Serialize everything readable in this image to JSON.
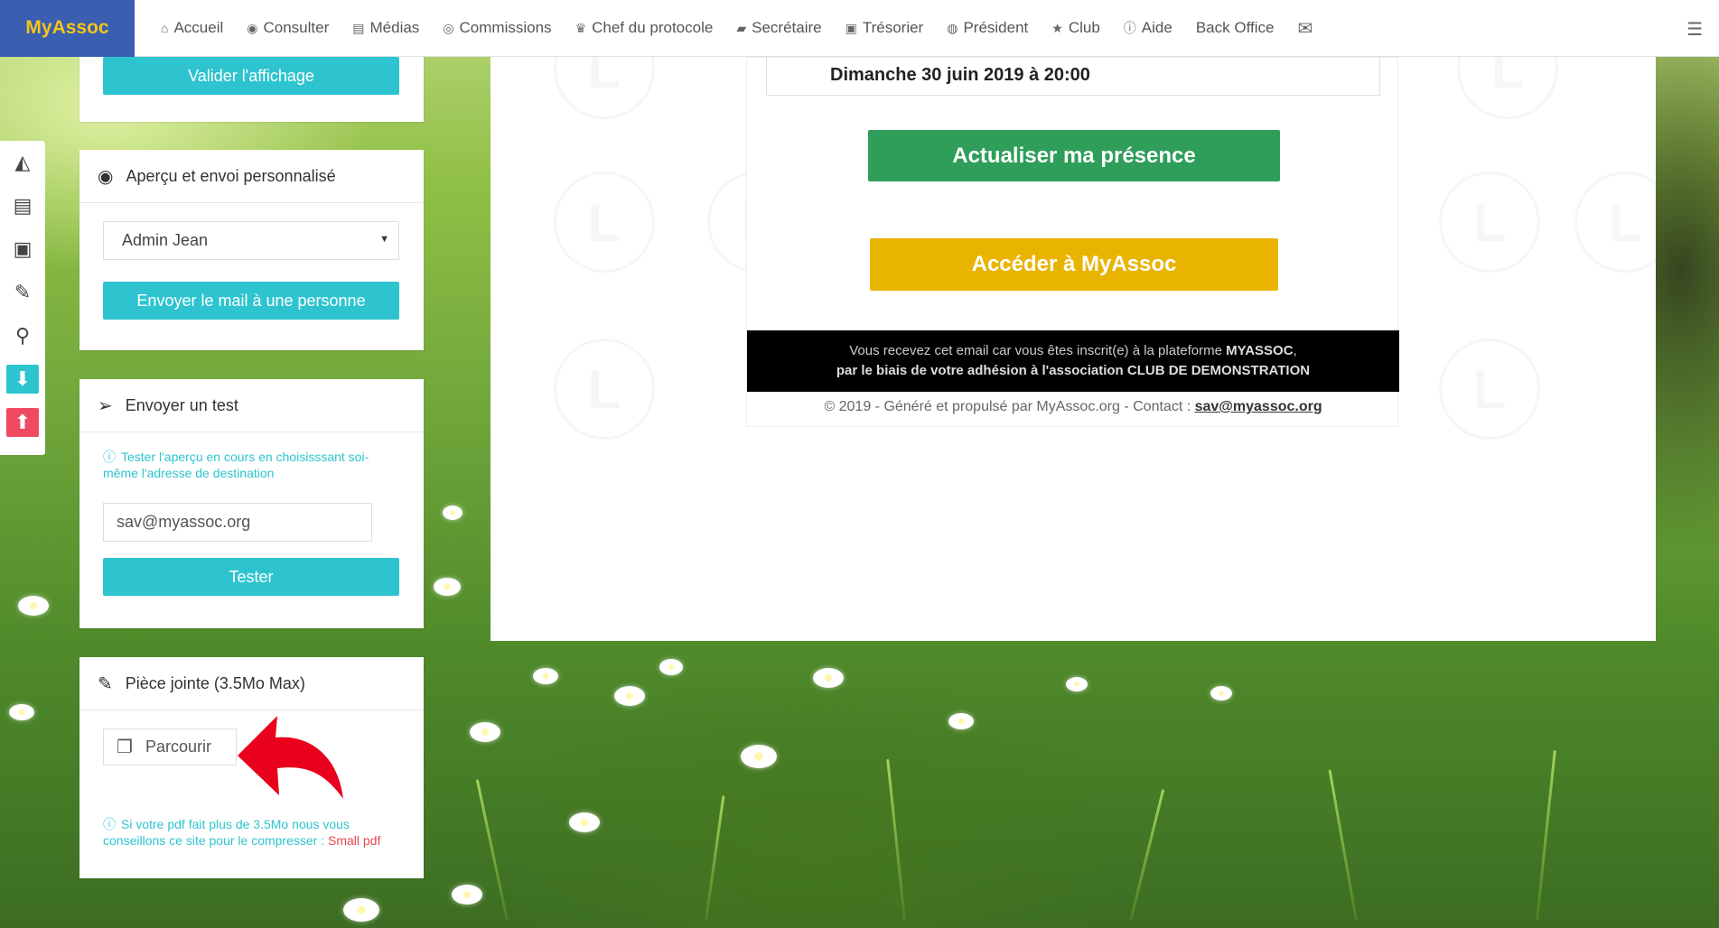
{
  "brand": "MyAssoc",
  "nav": [
    {
      "icon": "home-icon",
      "glyph": "⌂",
      "label": "Accueil"
    },
    {
      "icon": "eye-icon",
      "glyph": "◉",
      "label": "Consulter"
    },
    {
      "icon": "file-icon",
      "glyph": "▤",
      "label": "Médias"
    },
    {
      "icon": "users-icon",
      "glyph": "◎",
      "label": "Commissions"
    },
    {
      "icon": "trophy-icon",
      "glyph": "♛",
      "label": "Chef du protocole"
    },
    {
      "icon": "book-icon",
      "glyph": "▰",
      "label": "Secrétaire"
    },
    {
      "icon": "money-icon",
      "glyph": "▣",
      "label": "Trésorier"
    },
    {
      "icon": "globe-icon",
      "glyph": "◍",
      "label": "Président"
    },
    {
      "icon": "star-icon",
      "glyph": "★",
      "label": "Club"
    },
    {
      "icon": "info-icon",
      "glyph": "ⓘ",
      "label": "Aide"
    },
    {
      "icon": "",
      "glyph": "",
      "label": "Back Office"
    },
    {
      "icon": "envelope-icon",
      "glyph": "✉",
      "label": ""
    }
  ],
  "panels": {
    "display": {
      "button": "Valider l'affichage"
    },
    "preview": {
      "title": "Aperçu et envoi personnalisé",
      "selected_person": "Admin Jean",
      "button": "Envoyer le mail à une personne"
    },
    "test": {
      "title": "Envoyer un test",
      "hint": "Tester l'aperçu en cours en choisisssant soi-même l'adresse de destination",
      "email_value": "sav@myassoc.org",
      "button": "Tester"
    },
    "attachment": {
      "title": "Pièce jointe (3.5Mo Max)",
      "browse": "Parcourir",
      "hint": "Si votre pdf fait plus de 3.5Mo nous vous conseillons ce site pour le compresser :",
      "hint_link": "Small pdf"
    }
  },
  "email": {
    "date": "Dimanche 30 juin 2019 à 20:00",
    "btn_presence": "Actualiser ma présence",
    "btn_access": "Accéder à MyAssoc",
    "footer_line1_prefix": "Vous recevez cet email car vous êtes inscrit(e) à la plateforme ",
    "footer_line1_brand": "MYASSOC",
    "footer_line1_suffix": ",",
    "footer_line2": "par le biais de votre adhésion à l'association CLUB DE DEMONSTRATION",
    "copyright_prefix": "© 2019 - Généré et propulsé par MyAssoc.org - Contact : ",
    "contact": "sav@myassoc.org"
  },
  "colors": {
    "brand_bg": "#3a5fb0",
    "brand_text": "#f5c518",
    "teal": "#2ec4cf",
    "green": "#2e9e5a",
    "yellow": "#e9b400",
    "red_arrow": "#e8001c"
  }
}
